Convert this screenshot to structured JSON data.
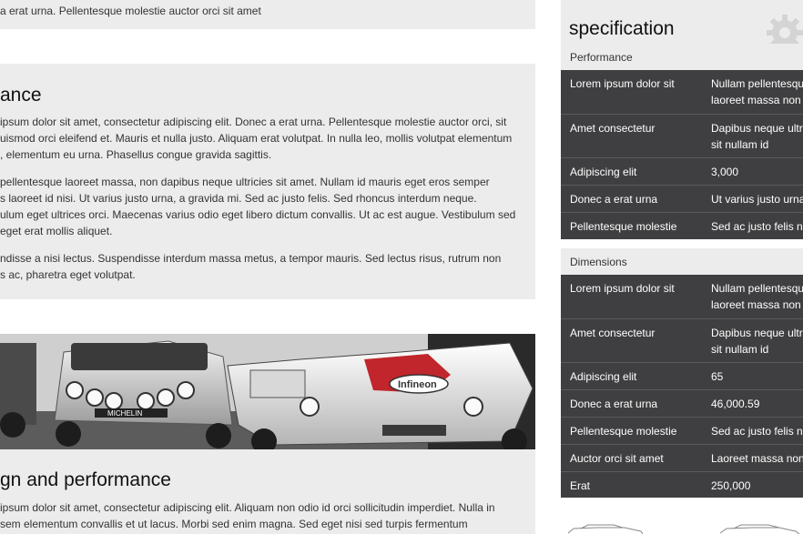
{
  "left": {
    "top_line": "a erat urna. Pellentesque molestie auctor orci sit amet",
    "section1": {
      "heading": "ance",
      "para1": [
        "ipsum dolor sit amet, consectetur adipiscing elit. Donec a erat urna. Pellentesque molestie auctor orci, sit",
        "uismod orci eleifend et. Mauris et nulla justo. Aliquam erat volutpat. In nulla leo, mollis volutpat elementum",
        ", elementum eu urna. Phasellus congue gravida sagittis."
      ],
      "para2": [
        "pellentesque laoreet massa, non dapibus neque ultricies sit amet. Nullam id mauris eget eros semper",
        "s laoreet id nisi. Ut varius justo urna, a gravida mi. Sed ac justo felis. Sed rhoncus interdum neque.",
        "ulum eget ultrices orci. Maecenas varius odio eget libero dictum convallis. Ut ac est augue. Vestibulum sed",
        "eget erat mollis aliquet."
      ],
      "para3": [
        "ndisse a nisi lectus. Suspendisse interdum massa metus, a tempor mauris. Sed lectus risus, rutrum non",
        "s ac, pharetra eget volutpat."
      ]
    },
    "hero": {
      "sponsor": "Infineon",
      "tire_brand": "MICHELIN"
    },
    "section2": {
      "heading": "gn and performance",
      "para1": [
        "ipsum dolor sit amet, consectetur adipiscing elit. Aliquam non odio id orci sollicitudin imperdiet. Nulla in",
        "sem elementum convallis et ut lacus. Morbi sed enim magna. Sed eget nisi sed turpis fermentum"
      ]
    }
  },
  "spec": {
    "title": "specification",
    "performance": {
      "label": "Performance",
      "rows": [
        {
          "key": "Lorem ipsum dolor sit",
          "value": [
            "Nullam pellentesqu",
            "laoreet massa non"
          ]
        },
        {
          "key": "Amet consectetur",
          "value": [
            "Dapibus neque ultr",
            "sit nullam id"
          ]
        },
        {
          "key": "Adipiscing elit",
          "value": [
            "3,000"
          ]
        },
        {
          "key": "Donec a erat urna",
          "value": [
            "Ut varius justo urna"
          ]
        },
        {
          "key": "Pellentesque molestie",
          "value": [
            "Sed ac justo felis n"
          ]
        }
      ]
    },
    "dimensions": {
      "label": "Dimensions",
      "rows": [
        {
          "key": "Lorem ipsum dolor sit",
          "value": [
            "Nullam pellentesqu",
            "laoreet massa non"
          ]
        },
        {
          "key": "Amet consectetur",
          "value": [
            "Dapibus neque ultr",
            "sit nullam id"
          ]
        },
        {
          "key": "Adipiscing elit",
          "value": [
            "65"
          ]
        },
        {
          "key": "Donec a erat urna",
          "value": [
            "46,000.59"
          ]
        },
        {
          "key": "Pellentesque molestie",
          "value": [
            "Sed ac justo felis n"
          ]
        },
        {
          "key": "Auctor orci sit amet",
          "value": [
            "Laoreet massa non"
          ]
        },
        {
          "key": "Erat",
          "value": [
            "250,000"
          ]
        }
      ]
    }
  },
  "colors": {
    "panel_bg": "#ececec",
    "table_bg": "#3f3f41",
    "table_divider": "#5a5a5c",
    "accent_red": "#c0262b"
  },
  "icons": [
    "gear-icon",
    "car-outline-icon"
  ]
}
